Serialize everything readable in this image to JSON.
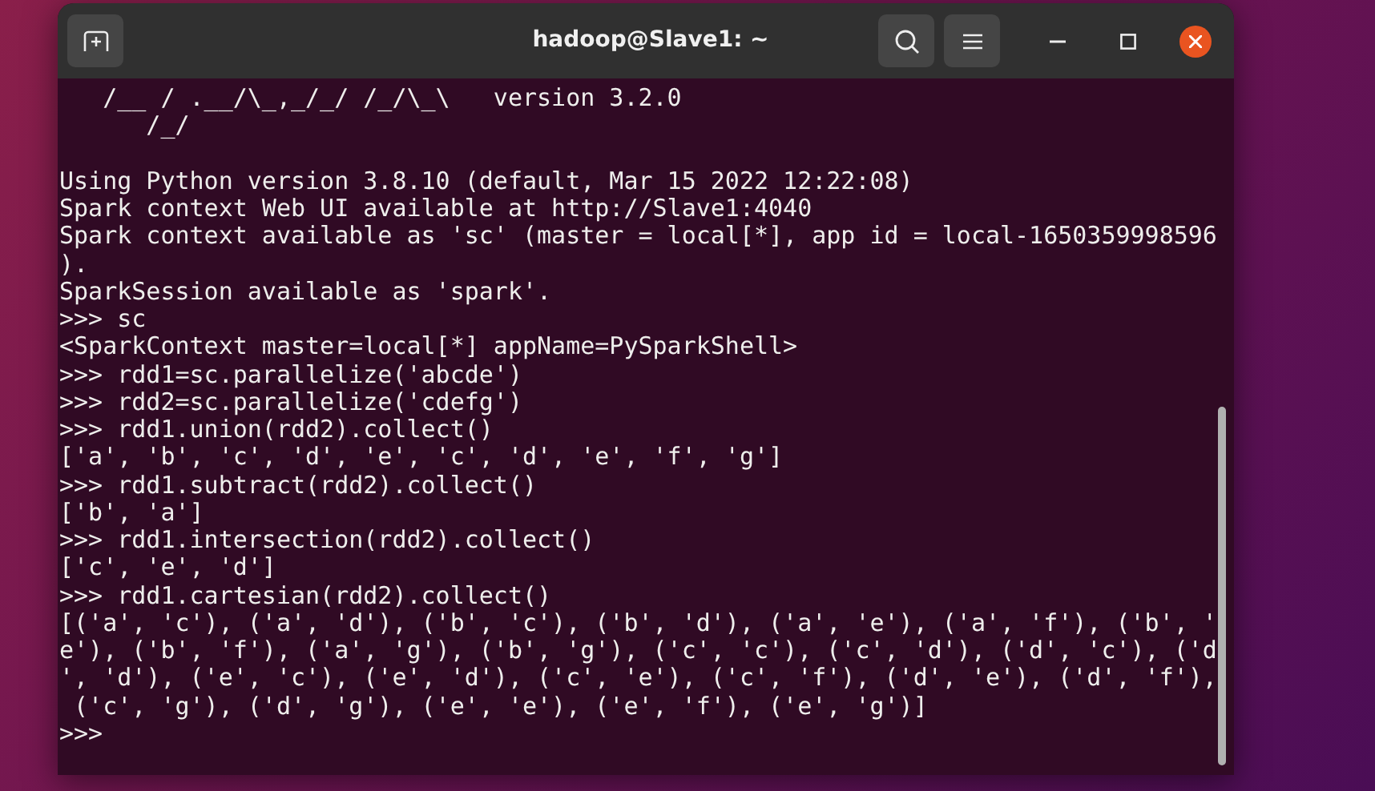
{
  "window": {
    "title": "hadoop@Slave1: ~"
  },
  "terminal": {
    "banner": [
      "   /__ / .__/\\_,_/_/ /_/\\_\\   version 3.2.0",
      "      /_/"
    ],
    "lines": [
      "Using Python version 3.8.10 (default, Mar 15 2022 12:22:08)",
      "Spark context Web UI available at http://Slave1:4040",
      "Spark context available as 'sc' (master = local[*], app id = local-1650359998596",
      ").",
      "SparkSession available as 'spark'.",
      ">>> sc",
      "<SparkContext master=local[*] appName=PySparkShell>",
      ">>> rdd1=sc.parallelize('abcde')",
      ">>> rdd2=sc.parallelize('cdefg')",
      ">>> rdd1.union(rdd2).collect()",
      "['a', 'b', 'c', 'd', 'e', 'c', 'd', 'e', 'f', 'g']",
      ">>> rdd1.subtract(rdd2).collect()",
      "['b', 'a']",
      ">>> rdd1.intersection(rdd2).collect()",
      "['c', 'e', 'd']",
      ">>> rdd1.cartesian(rdd2).collect()",
      "[('a', 'c'), ('a', 'd'), ('b', 'c'), ('b', 'd'), ('a', 'e'), ('a', 'f'), ('b', '",
      "e'), ('b', 'f'), ('a', 'g'), ('b', 'g'), ('c', 'c'), ('c', 'd'), ('d', 'c'), ('d",
      "', 'd'), ('e', 'c'), ('e', 'd'), ('c', 'e'), ('c', 'f'), ('d', 'e'), ('d', 'f'),",
      " ('c', 'g'), ('d', 'g'), ('e', 'e'), ('e', 'f'), ('e', 'g')]",
      ">>>"
    ]
  }
}
